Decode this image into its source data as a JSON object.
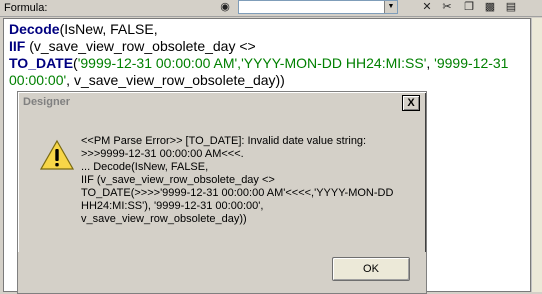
{
  "formula_bar": {
    "label": "Formula:",
    "icons": [
      "binoculars-icon",
      "cut-icon",
      "copy-icon",
      "paste-icon",
      "x-icon",
      "find-icon"
    ]
  },
  "editor": {
    "lines": [
      {
        "kw": "Decode",
        "rest": "(IsNew, FALSE,"
      },
      {
        "kw": "IIF",
        "rest": " (v_save_view_row_obsolete_day <>"
      },
      {
        "kw": "TO_DATE",
        "pre": "(",
        "str": "'9999-12-31 00:00:00 AM','YYYY-MON-DD HH24:MI:SS'",
        "mid": ", ",
        "str2": "'9999-12-31"
      },
      {
        "str": "00:00:00'",
        "rest": ", v_save_view_row_obsolete_day))"
      }
    ]
  },
  "dialog": {
    "title": "Designer",
    "close_label": "X",
    "message": "<<PM Parse Error>> [TO_DATE]: Invalid date value string:\n>>>9999-12-31 00:00:00 AM<<<.\n... Decode(IsNew, FALSE,\nIIF (v_save_view_row_obsolete_day <>\nTO_DATE(>>>>'9999-12-31 00:00:00 AM'<<<<,'YYYY-MON-DD\nHH24:MI:SS'), '9999-12-31 00:00:00',\nv_save_view_row_obsolete_day))",
    "ok_label": "OK"
  }
}
